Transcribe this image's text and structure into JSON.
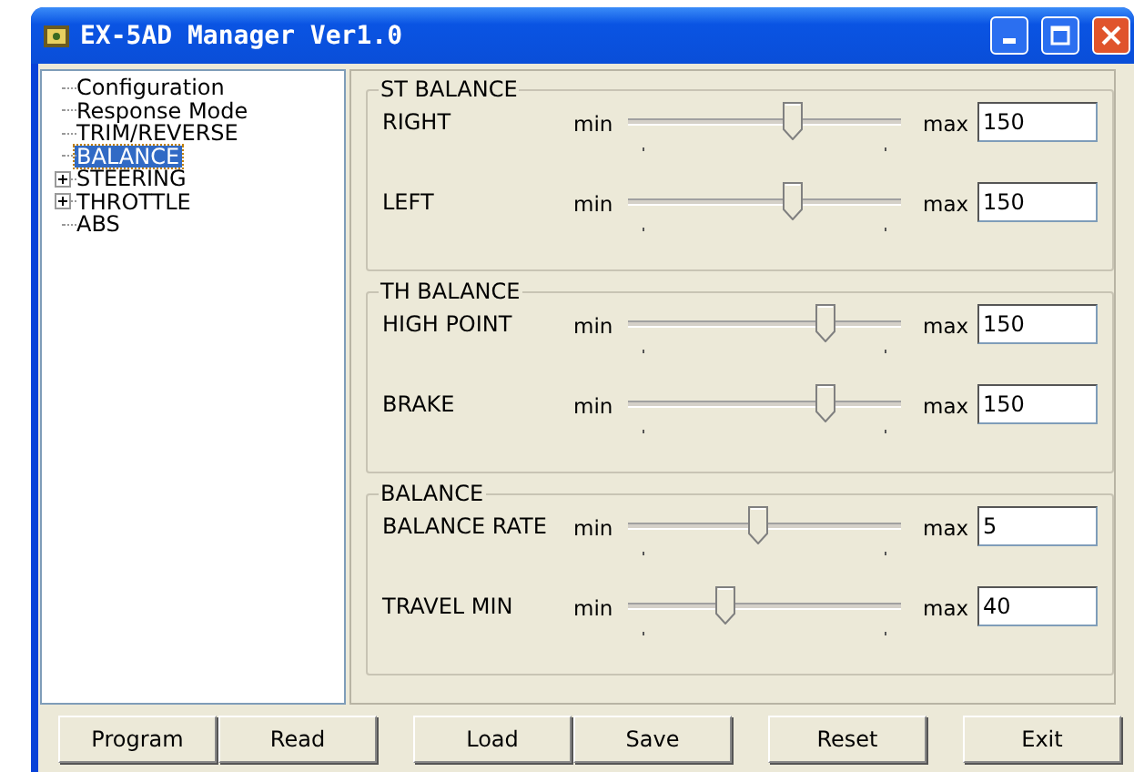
{
  "window": {
    "title": "EX-5AD Manager Ver1.0"
  },
  "tree": [
    {
      "label": "Configuration",
      "selected": false
    },
    {
      "label": "Response Mode",
      "selected": false
    },
    {
      "label": "TRIM/REVERSE",
      "selected": false
    },
    {
      "label": "BALANCE",
      "selected": true
    },
    {
      "label": "STEERING",
      "selected": false,
      "expanded": false
    },
    {
      "label": "THROTTLE",
      "selected": false,
      "expanded": false
    },
    {
      "label": "ABS",
      "selected": false
    }
  ],
  "groups": [
    {
      "title": "ST BALANCE",
      "rows": [
        {
          "label": "RIGHT",
          "min": "min",
          "max": "max",
          "level": 0.6,
          "value": "150"
        },
        {
          "label": "LEFT",
          "min": "min",
          "max": "max",
          "level": 0.6,
          "value": "150"
        }
      ]
    },
    {
      "title": "TH BALANCE",
      "rows": [
        {
          "label": "HIGH POINT",
          "min": "min",
          "max": "max",
          "level": 0.72,
          "value": "150"
        },
        {
          "label": "BRAKE",
          "min": "min",
          "max": "max",
          "level": 0.72,
          "value": "150"
        }
      ]
    },
    {
      "title": "BALANCE",
      "rows": [
        {
          "label": "BALANCE RATE",
          "min": "min",
          "max": "max",
          "level": 0.47,
          "value": "5"
        },
        {
          "label": "TRAVEL MIN",
          "min": "min",
          "max": "max",
          "level": 0.35,
          "value": "40"
        }
      ]
    }
  ],
  "buttons": [
    [
      "Program",
      "Read"
    ],
    [
      "Load",
      "Save"
    ],
    [
      "Reset"
    ],
    [
      "Exit"
    ]
  ]
}
